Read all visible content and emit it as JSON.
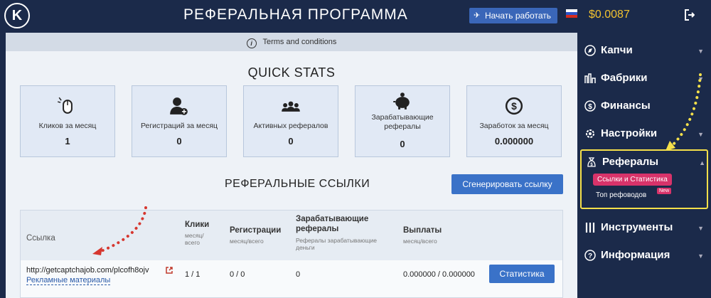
{
  "header": {
    "logo_letter": "K",
    "title": "РЕФЕРАЛЬНАЯ ПРОГРАММА",
    "start_button": "Начать работать",
    "balance": "$0.0087"
  },
  "terms": {
    "label": "Terms and conditions"
  },
  "quick_stats": {
    "title": "QUICK STATS",
    "cards": [
      {
        "icon": "mouse-click-icon",
        "label": "Кликов за месяц",
        "value": "1"
      },
      {
        "icon": "user-add-icon",
        "label": "Регистраций за месяц",
        "value": "0"
      },
      {
        "icon": "users-group-icon",
        "label": "Активных рефералов",
        "value": "0"
      },
      {
        "icon": "piggy-bank-icon",
        "label": "Зарабатывающие рефералы",
        "value": "0"
      },
      {
        "icon": "dollar-coin-icon",
        "label": "Заработок за месяц",
        "value": "0.000000"
      }
    ]
  },
  "referral_links": {
    "title": "РЕФЕРАЛЬНЫЕ ССЫЛКИ",
    "generate_button": "Сгенерировать ссылку",
    "columns": [
      {
        "title": "Ссылка",
        "sub": ""
      },
      {
        "title": "Клики",
        "sub": "месяц/всего"
      },
      {
        "title": "Регистрации",
        "sub": "месяц/всего"
      },
      {
        "title": "Зарабатывающие рефералы",
        "sub": "Рефералы зарабатывающие деньги"
      },
      {
        "title": "Выплаты",
        "sub": "месяц/всего"
      }
    ],
    "rows": [
      {
        "link": "http://getcaptchajob.com/plcofh8ojv",
        "promo_link": "Рекламные материалы",
        "clicks": "1 / 1",
        "registrations": "0 / 0",
        "earning_refs": "0",
        "payouts": "0.000000 / 0.000000",
        "stats_button": "Статистика"
      }
    ]
  },
  "sidebar": {
    "items": [
      {
        "label": "Капчи",
        "icon": "compass-icon"
      },
      {
        "label": "Фабрики",
        "icon": "factory-icon"
      },
      {
        "label": "Финансы",
        "icon": "dollar-circle-icon"
      },
      {
        "label": "Настройки",
        "icon": "gear-icon"
      },
      {
        "label": "Рефералы",
        "icon": "money-bag-icon"
      },
      {
        "label": "Инструменты",
        "icon": "tools-icon"
      },
      {
        "label": "Информация",
        "icon": "question-icon"
      }
    ],
    "sub_active": "Ссылки и Статистика",
    "sub_top": "Топ рефоводов",
    "new_badge": "New"
  },
  "colors": {
    "header_bg": "#1b2a4a",
    "accent": "#3a72c8",
    "balance": "#f2c230",
    "pink": "#d8336a",
    "highlight": "#f5e04a"
  }
}
